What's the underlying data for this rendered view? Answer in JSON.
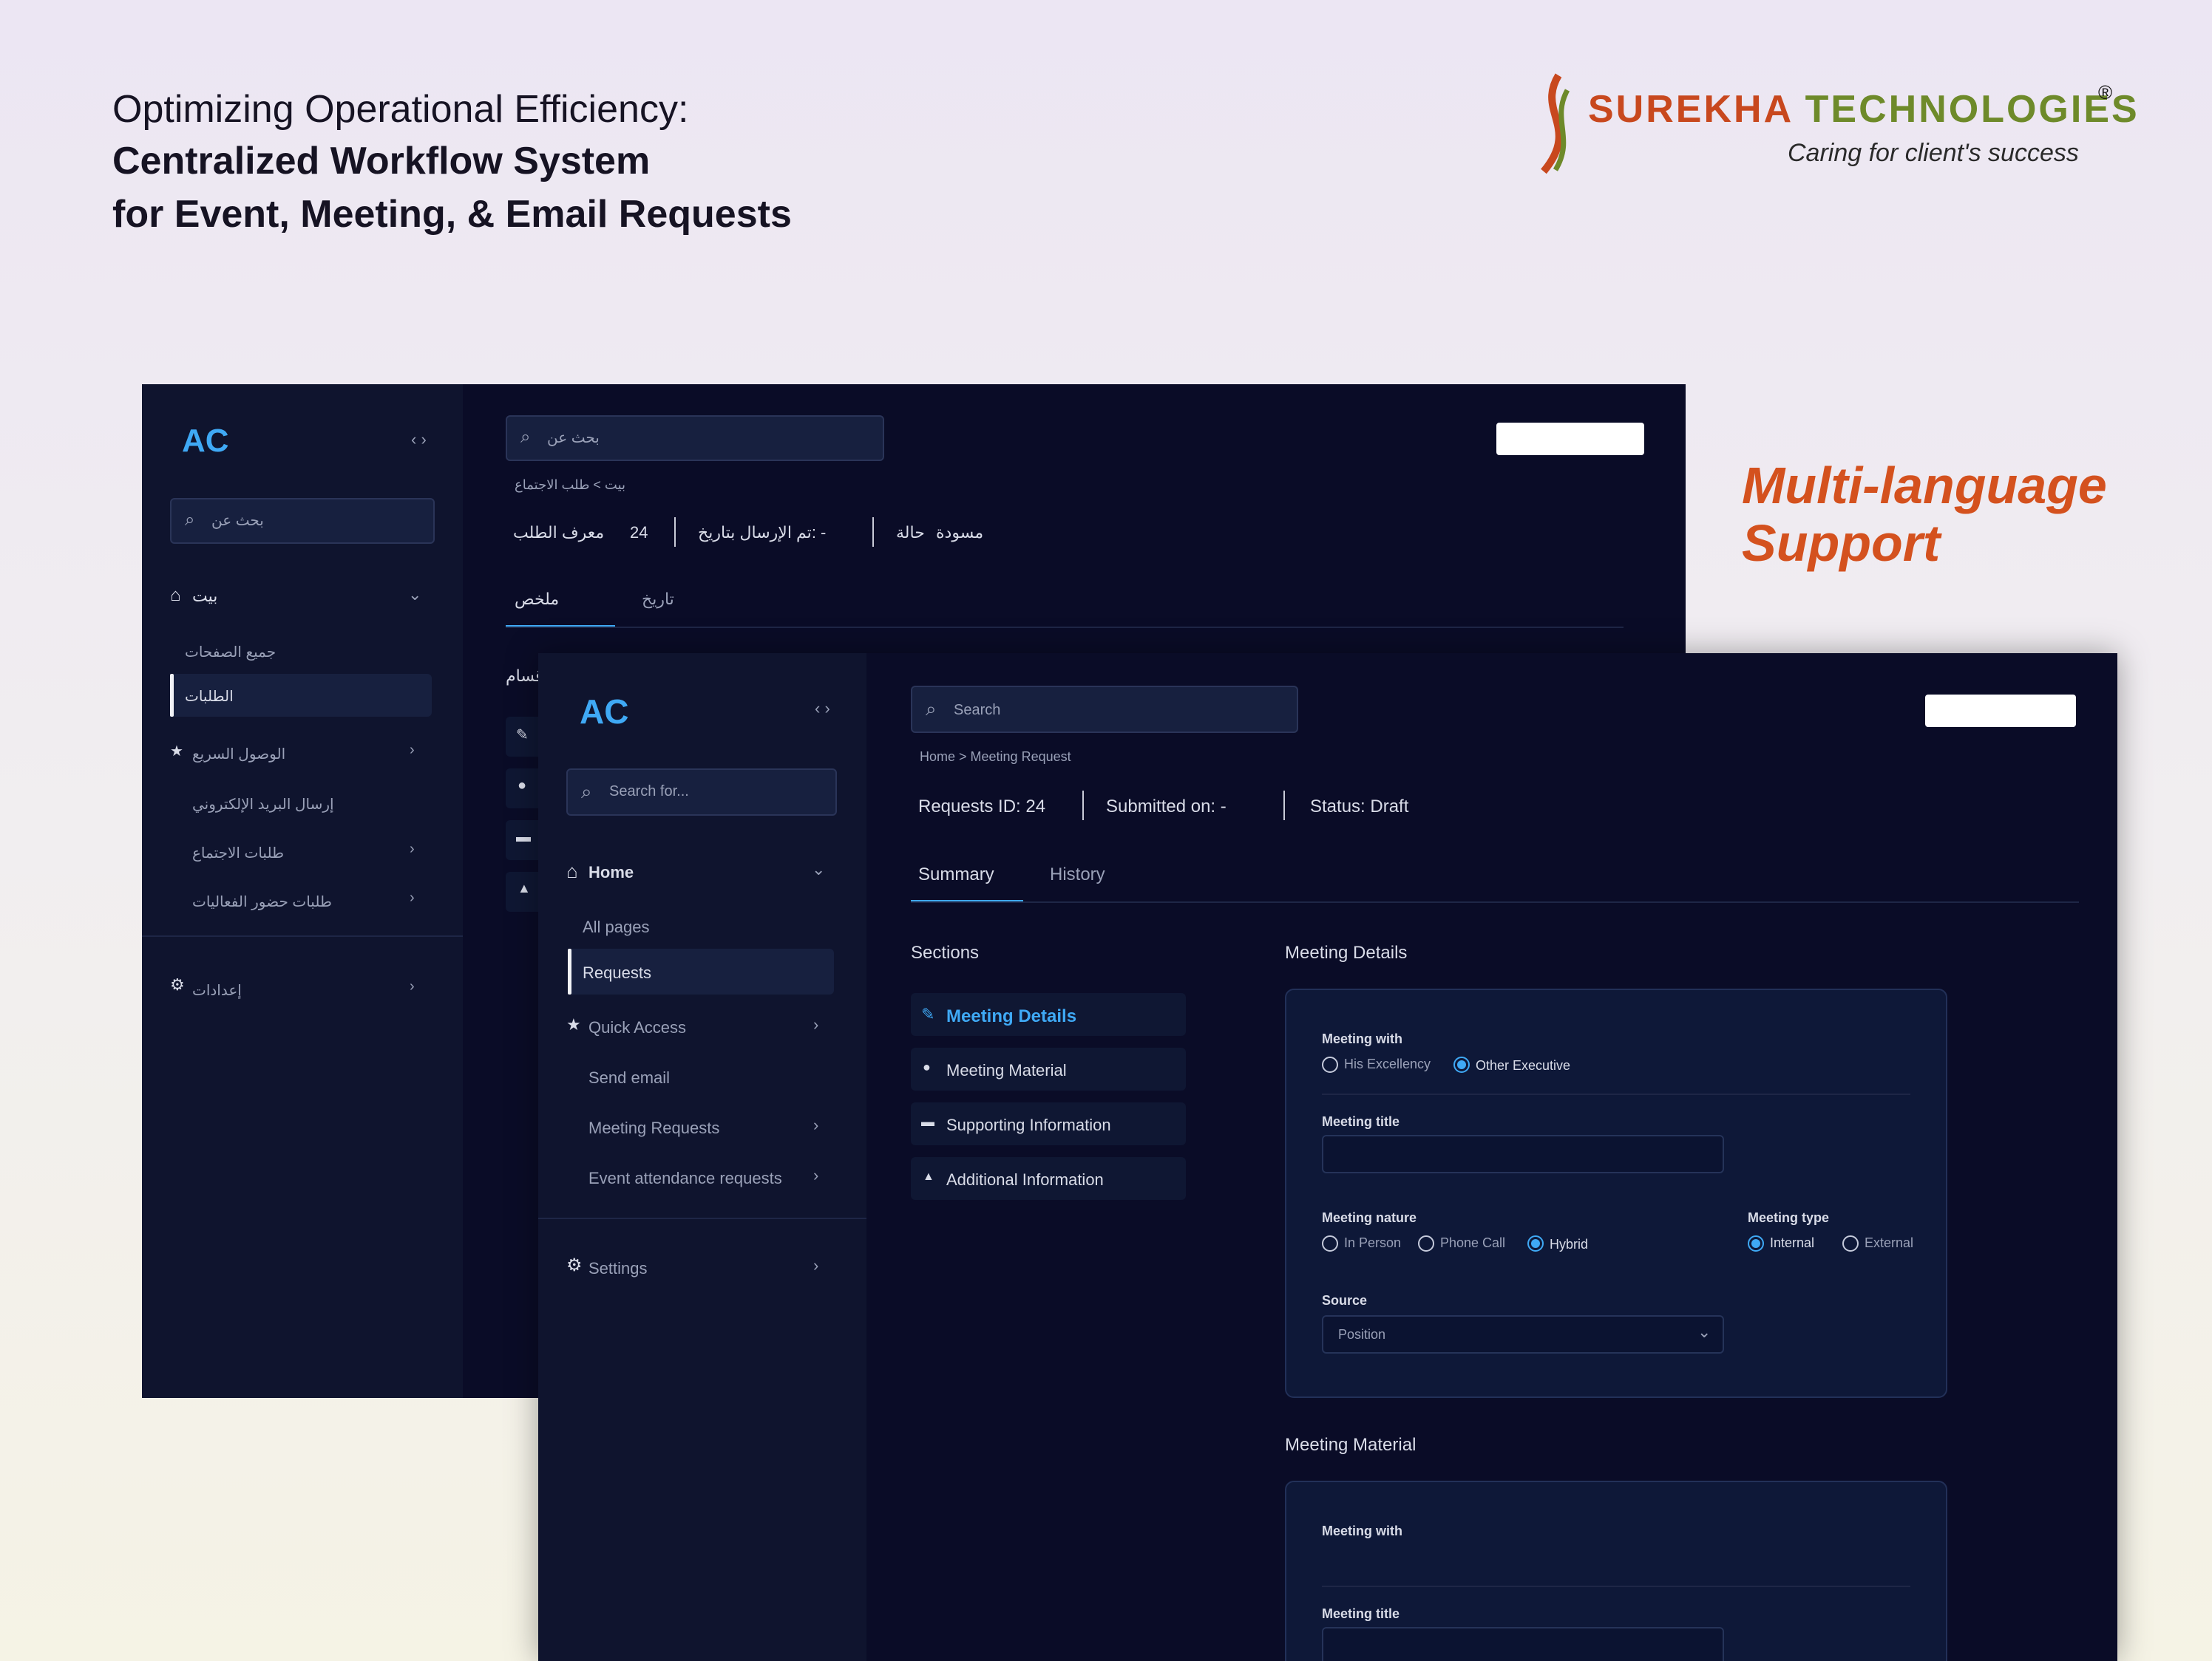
{
  "header": {
    "line1": "Optimizing Operational Efficiency:",
    "line2": "Centralized Workflow System",
    "line3": "for Event, Meeting, & Email Requests"
  },
  "brand": {
    "name_part1": "SUREKHA",
    "name_part2": "TECHNOLOGIES",
    "registered": "®",
    "tagline": "Caring for client's success"
  },
  "feature_callout": {
    "line1": "Multi-language",
    "line2": "Support"
  },
  "arabic_window": {
    "logo": "AC",
    "search_placeholder": "بحث عن",
    "top_search_placeholder": "بحث عن",
    "nav": {
      "home": "بيت",
      "all_pages": "جميع الصفحات",
      "requests": "الطلبات",
      "quick_access": "الوصول السريع",
      "send_email": "إرسال البريد الإلكتروني",
      "meeting_requests": "طلبات الاجتماع",
      "event_requests": "طلبات حضور الفعاليات",
      "settings": "إعدادات"
    },
    "breadcrumb": "بيت > طلب الاجتماع",
    "request_id_label": "معرف الطلب",
    "request_id_value": "24",
    "submitted_label": "تم الإرسال بتاريخ: -",
    "status_label": "حالة",
    "status_value": "مسودة",
    "tabs": {
      "summary": "ملخص",
      "history": "تاريخ"
    },
    "sections_partial": "أقسام"
  },
  "english_window": {
    "logo": "AC",
    "top_search_placeholder": "Search",
    "sidebar_search_placeholder": "Search for...",
    "nav": {
      "home": "Home",
      "all_pages": "All pages",
      "requests": "Requests",
      "quick_access": "Quick Access",
      "send_email": "Send email",
      "meeting_requests": "Meeting Requests",
      "event_requests": "Event attendance requests",
      "settings": "Settings"
    },
    "breadcrumb": "Home > Meeting Request",
    "request_id": "Requests ID:  24",
    "submitted": "Submitted on: -",
    "status": "Status: Draft",
    "tabs": {
      "summary": "Summary",
      "history": "History"
    },
    "sections_title": "Sections",
    "sections": [
      "Meeting Details",
      "Meeting Material",
      "Supporting Information",
      "Additional Information"
    ],
    "meeting_details": {
      "title": "Meeting Details",
      "meeting_with_label": "Meeting with",
      "meeting_with_options": [
        "His Excellency",
        "Other Executive"
      ],
      "meeting_with_selected": "Other Executive",
      "meeting_title_label": "Meeting title",
      "meeting_title_value": "",
      "meeting_nature_label": "Meeting nature",
      "meeting_nature_options": [
        "In Person",
        "Phone Call",
        "Hybrid"
      ],
      "meeting_nature_selected": "Hybrid",
      "meeting_type_label": "Meeting type",
      "meeting_type_options": [
        "Internal",
        "External"
      ],
      "meeting_type_selected": "Internal",
      "source_label": "Source",
      "source_value": "Position"
    },
    "meeting_material": {
      "title": "Meeting Material",
      "meeting_with_label": "Meeting with",
      "meeting_title_label": "Meeting title"
    }
  },
  "colors": {
    "accent": "#3FA9F5",
    "window_bg": "#0A0C27",
    "sidebar_bg": "#0F142E",
    "brand_orange": "#C8481E",
    "brand_green": "#6E8A2A",
    "callout": "#D4511E"
  },
  "icons": [
    "search-icon",
    "home-icon",
    "star-icon",
    "gear-icon",
    "chevron-down-icon",
    "chevron-right-icon",
    "collapse-icon",
    "pencil-icon",
    "user-icon",
    "card-icon",
    "bell-icon",
    "logo-icon"
  ]
}
